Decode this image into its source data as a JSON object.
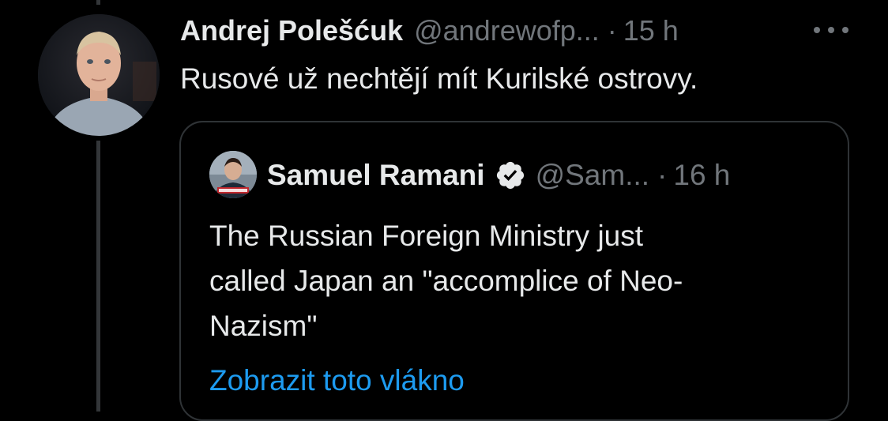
{
  "tweet": {
    "author_name": "Andrej Polešćuk",
    "author_handle": "@andrewofp...",
    "separator": "·",
    "time": "15 h",
    "text": "Rusové už nechtějí mít Kurilské ostrovy.",
    "avatar_icon": "user-photo-icon",
    "more_icon": "more-dots-icon"
  },
  "quote": {
    "author_name": "Samuel Ramani",
    "verified_icon": "verified-badge-icon",
    "author_handle": "@Sam...",
    "separator": "·",
    "time": "16 h",
    "text": "The Russian Foreign Ministry just\ncalled Japan an \"accomplice of Neo-\nNazism\"",
    "show_thread_label": "Zobrazit toto vlákno"
  },
  "colors": {
    "background": "#000000",
    "primary_text": "#e7e9ea",
    "secondary_text": "#71767b",
    "link": "#1d9bf0",
    "border": "#2f3336"
  }
}
